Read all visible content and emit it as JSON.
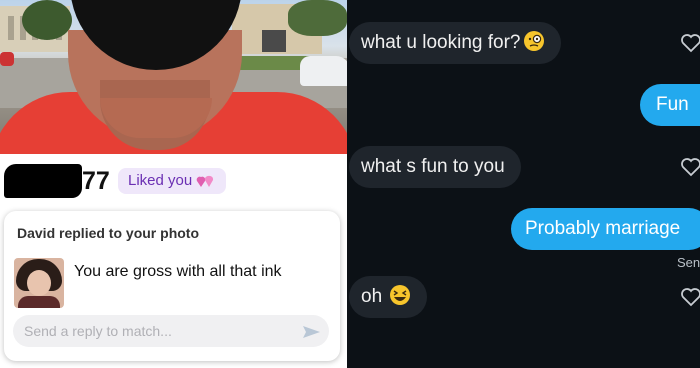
{
  "profile": {
    "age": "77",
    "liked_badge": "Liked you",
    "accent_color": "#6b2fb3"
  },
  "reply_card": {
    "title": "David replied to your photo",
    "message": "You are gross with all that ink",
    "reply_placeholder": "Send a reply to match..."
  },
  "chat": {
    "messages": [
      {
        "side": "received",
        "text": "what u looking for?",
        "emoji": "face-with-monocle"
      },
      {
        "side": "sent",
        "text": "Fun"
      },
      {
        "side": "received",
        "text": "what s fun to you"
      },
      {
        "side": "sent",
        "text": "Probably marriage"
      },
      {
        "side": "received",
        "text": "oh",
        "emoji": "grinning-squinting-face"
      }
    ],
    "status": "Sen",
    "colors": {
      "received": "#1f252c",
      "sent": "#23a9ee",
      "background": "#0c1116"
    }
  }
}
